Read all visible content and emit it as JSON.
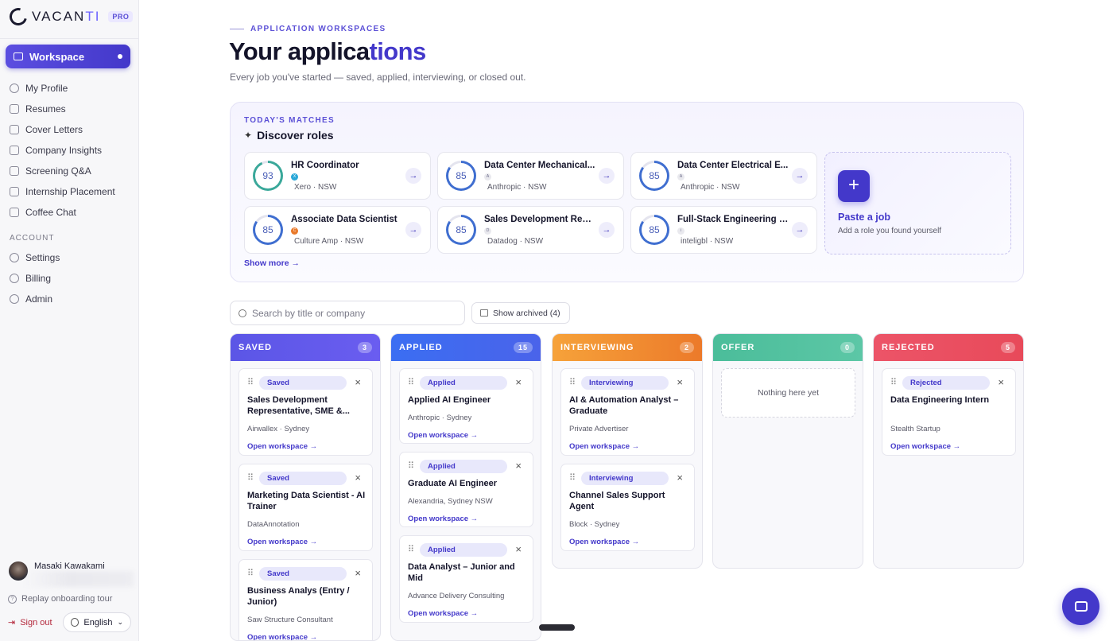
{
  "brand": {
    "name_a": "VACAN",
    "name_b": "TI",
    "tier": "PRO"
  },
  "sidebar": {
    "workspace": "Workspace",
    "items": [
      {
        "label": "My Profile",
        "icon": "user-icon"
      },
      {
        "label": "Resumes",
        "icon": "file-icon"
      },
      {
        "label": "Cover Letters",
        "icon": "document-icon"
      },
      {
        "label": "Company Insights",
        "icon": "building-icon"
      },
      {
        "label": "Screening Q&A",
        "icon": "chat-icon"
      },
      {
        "label": "Internship Placement",
        "icon": "graduation-cap-icon"
      },
      {
        "label": "Coffee Chat",
        "icon": "coffee-icon"
      }
    ],
    "account_label": "ACCOUNT",
    "account_items": [
      {
        "label": "Settings",
        "icon": "gear-icon"
      },
      {
        "label": "Billing",
        "icon": "credit-card-icon"
      },
      {
        "label": "Admin",
        "icon": "shield-icon"
      }
    ],
    "user_name": "Masaki Kawakami",
    "replay": "Replay onboarding tour",
    "signout": "Sign out",
    "language": "English"
  },
  "header": {
    "eyebrow": "APPLICATION WORKSPACES",
    "title_a": "Your applica",
    "title_b": "tions",
    "subtitle": "Every job you've started — saved, applied, interviewing, or closed out."
  },
  "matches": {
    "label": "TODAY'S MATCHES",
    "heading": "Discover roles",
    "show_more": "Show more →",
    "cards": [
      {
        "score": "93",
        "title": "HR Coordinator",
        "logo": "X",
        "logo_color": "#2aa8d8",
        "meta": "Xero · NSW",
        "ring": "#3aa89a"
      },
      {
        "score": "85",
        "title": "Data Center Mechanical...",
        "logo": "A",
        "logo_color": "#e9e9ee",
        "meta": "Anthropic · NSW",
        "ring": "#3f6ed0"
      },
      {
        "score": "85",
        "title": "Data Center Electrical E...",
        "logo": "A",
        "logo_color": "#e9e9ee",
        "meta": "Anthropic · NSW",
        "ring": "#3f6ed0"
      },
      {
        "score": "85",
        "title": "Associate Data Scientist",
        "logo": "C",
        "logo_color": "#e97a2b",
        "meta": "Culture Amp · NSW",
        "ring": "#3f6ed0"
      },
      {
        "score": "85",
        "title": "Sales Development Repr...",
        "logo": "D",
        "logo_color": "#e9e9ee",
        "meta": "Datadog · NSW",
        "ring": "#3f6ed0"
      },
      {
        "score": "85",
        "title": "Full-Stack Engineering I...",
        "logo": "i",
        "logo_color": "#e9e9ee",
        "meta": "inteligbl · NSW",
        "ring": "#3f6ed0"
      }
    ],
    "paste_title": "Paste a job",
    "paste_sub": "Add a role you found yourself"
  },
  "toolbar": {
    "search_placeholder": "Search by title or company",
    "archived": "Show archived (4)"
  },
  "columns": [
    {
      "name": "SAVED",
      "count": "3",
      "color": "#5b56e6",
      "cards": [
        {
          "badge": "Saved",
          "title": "Sales Development Representative, SME &...",
          "company": "Airwallex · Sydney",
          "link": "Open workspace →"
        },
        {
          "badge": "Saved",
          "title": "Marketing Data Scientist - AI Trainer",
          "company": "DataAnnotation",
          "link": "Open workspace →"
        },
        {
          "badge": "Saved",
          "title": "Business Analys (Entry / Junior)",
          "company": "Saw Structure Consultant",
          "link": "Open workspace →"
        }
      ]
    },
    {
      "name": "APPLIED",
      "count": "15",
      "color": "#3b6ef2",
      "cards": [
        {
          "badge": "Applied",
          "title": "Applied AI Engineer",
          "company": "Anthropic · Sydney",
          "link": "Open workspace →"
        },
        {
          "badge": "Applied",
          "title": "Graduate AI Engineer",
          "company": "Alexandria, Sydney NSW",
          "link": "Open workspace →"
        },
        {
          "badge": "Applied",
          "title": "Data Analyst – Junior and Mid",
          "company": "Advance Delivery Consulting",
          "link": "Open workspace →"
        }
      ]
    },
    {
      "name": "INTERVIEWING",
      "count": "2",
      "color": "#f08a2a",
      "cards": [
        {
          "badge": "Interviewing",
          "title": "AI & Automation Analyst – Graduate",
          "company": "Private Advertiser",
          "link": "Open workspace →"
        },
        {
          "badge": "Interviewing",
          "title": "Channel Sales Support Agent",
          "company": "Block · Sydney",
          "link": "Open workspace →"
        }
      ]
    },
    {
      "name": "OFFER",
      "count": "0",
      "color": "#4bbd9a",
      "empty": "Nothing here yet",
      "cards": []
    },
    {
      "name": "REJECTED",
      "count": "5",
      "color": "#ea4b5e",
      "cards": [
        {
          "badge": "Rejected",
          "title": "Data Engineering Intern",
          "company": "Stealth Startup",
          "link": "Open workspace →"
        }
      ]
    }
  ]
}
